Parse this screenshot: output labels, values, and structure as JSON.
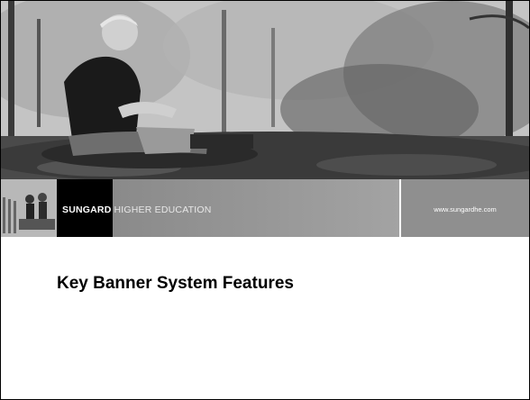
{
  "banner": {
    "brand": "SUNGARD",
    "division": "HIGHER EDUCATION",
    "website": "www.sungardhe.com"
  },
  "slide": {
    "title": "Key Banner System Features"
  },
  "colors": {
    "brand_block": "#000000",
    "band": "#9a9a9a",
    "title_text": "#000000"
  }
}
